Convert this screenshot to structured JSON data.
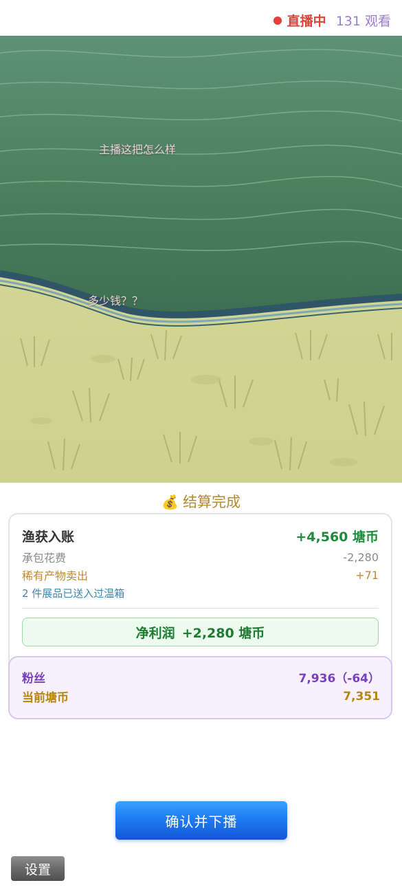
{
  "header": {
    "live_label": "直播中",
    "viewers": "131 观看"
  },
  "danmaku": [
    "主播这把怎么样",
    "多少钱？？"
  ],
  "settlement": {
    "title": "结算完成",
    "icon": "money-bag-icon",
    "catch_label": "渔获入账",
    "catch_value": "+4,560 塘币",
    "fee_label": "承包花费",
    "fee_value": "-2,280",
    "rare_label": "稀有产物卖出",
    "rare_value": "+71",
    "greenhouse_note": "2 件展品已送入过温箱",
    "profit_label": "净利润",
    "profit_value": "+2,280 塘币",
    "fans_label": "粉丝",
    "fans_value": "7,936（-64）",
    "coins_label": "当前塘币",
    "coins_value": "7,351"
  },
  "buttons": {
    "confirm": "确认并下播",
    "settings": "设置"
  },
  "colors": {
    "live_red": "#d9443c",
    "profit_green": "#1f8a3b",
    "fans_purple": "#7a3fbf",
    "coin_gold": "#b8860b",
    "confirm_blue": "#1f7cf2"
  }
}
